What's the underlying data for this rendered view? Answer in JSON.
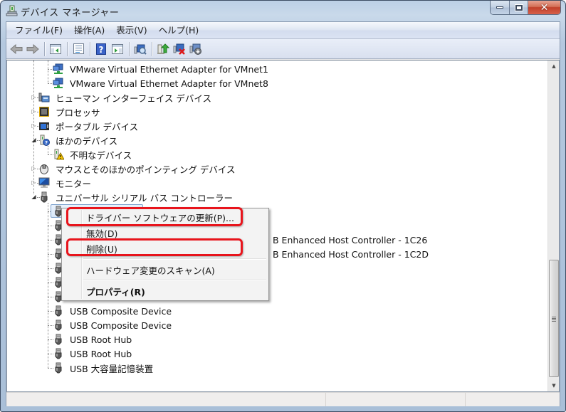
{
  "window": {
    "title": "デバイス マネージャー",
    "controls": {
      "minimize": "minimize",
      "maximize": "maximize",
      "close": "close"
    }
  },
  "menubar": {
    "items": [
      {
        "label": "ファイル(F)"
      },
      {
        "label": "操作(A)"
      },
      {
        "label": "表示(V)"
      },
      {
        "label": "ヘルプ(H)"
      }
    ]
  },
  "toolbar": {
    "buttons": [
      {
        "icon": "back-arrow-icon",
        "tooltip": "Back"
      },
      {
        "icon": "forward-arrow-icon",
        "tooltip": "Forward"
      },
      {
        "icon": "show-hide-console-tree-icon"
      },
      {
        "icon": "properties-icon"
      },
      {
        "icon": "help-icon"
      },
      {
        "icon": "show-hide-action-pane-icon"
      },
      {
        "icon": "scan-hardware-changes-icon"
      },
      {
        "icon": "update-driver-icon"
      },
      {
        "icon": "uninstall-device-icon"
      },
      {
        "icon": "disable-device-icon"
      }
    ]
  },
  "tree": {
    "items": [
      {
        "label": "VMware Virtual Ethernet Adapter for VMnet1",
        "level": 2,
        "icon": "network-adapter-icon"
      },
      {
        "label": "VMware Virtual Ethernet Adapter for VMnet8",
        "level": 2,
        "icon": "network-adapter-icon"
      },
      {
        "label": "ヒューマン インターフェイス デバイス",
        "level": 1,
        "icon": "hid-icon",
        "expanded": false
      },
      {
        "label": "プロセッサ",
        "level": 1,
        "icon": "processor-icon",
        "expanded": false
      },
      {
        "label": "ポータブル デバイス",
        "level": 1,
        "icon": "portable-device-icon",
        "expanded": false
      },
      {
        "label": "ほかのデバイス",
        "level": 1,
        "icon": "other-devices-icon",
        "expanded": true
      },
      {
        "label": "不明なデバイス",
        "level": 2,
        "icon": "unknown-device-warning-icon"
      },
      {
        "label": "マウスとそのほかのポインティング デバイス",
        "level": 1,
        "icon": "mouse-icon",
        "expanded": false
      },
      {
        "label": "モニター",
        "level": 1,
        "icon": "monitor-icon",
        "expanded": false
      },
      {
        "label": "ユニバーサル シリアル バス コントローラー",
        "level": 1,
        "icon": "usb-icon",
        "expanded": true
      },
      {
        "label": "",
        "level": 2,
        "icon": "usb-icon",
        "selected": true
      },
      {
        "label": "",
        "level": 2,
        "icon": "usb-icon"
      },
      {
        "label": "B Enhanced Host Controller - 1C26",
        "level": 2,
        "icon": "usb-icon"
      },
      {
        "label": "B Enhanced Host Controller - 1C2D",
        "level": 2,
        "icon": "usb-icon"
      },
      {
        "label": "",
        "level": 2,
        "icon": "usb-icon"
      },
      {
        "label": "",
        "level": 2,
        "icon": "usb-icon"
      },
      {
        "label": "",
        "level": 2,
        "icon": "usb-icon"
      },
      {
        "label": "USB Composite Device",
        "level": 2,
        "icon": "usb-icon"
      },
      {
        "label": "USB Composite Device",
        "level": 2,
        "icon": "usb-icon"
      },
      {
        "label": "USB Root Hub",
        "level": 2,
        "icon": "usb-icon"
      },
      {
        "label": "USB Root Hub",
        "level": 2,
        "icon": "usb-icon"
      },
      {
        "label": "USB 大容量記憶装置",
        "level": 2,
        "icon": "usb-icon"
      }
    ]
  },
  "context_menu": {
    "items": [
      {
        "label": "ドライバー ソフトウェアの更新(P)...",
        "highlighted": true
      },
      {
        "label": "無効(D)"
      },
      {
        "label": "削除(U)",
        "highlighted": true
      },
      {
        "separator": true
      },
      {
        "label": "ハードウェア変更のスキャン(A)"
      },
      {
        "separator": true
      },
      {
        "label": "プロパティ(R)",
        "bold": true
      }
    ],
    "highlight_color": "#e8141c"
  },
  "scrollbar": {
    "position_fraction": 0.62,
    "visible_fraction": 0.38
  },
  "statusbar": {
    "cells": [
      "",
      "",
      ""
    ]
  }
}
